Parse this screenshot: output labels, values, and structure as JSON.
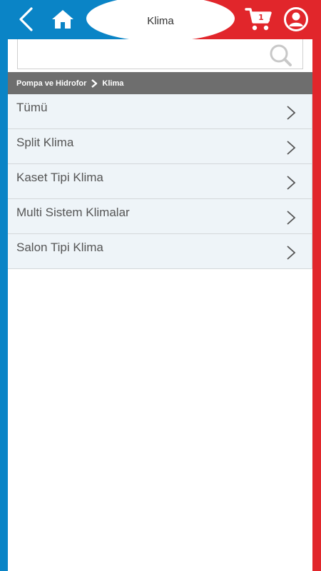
{
  "header": {
    "title": "Klima",
    "icons": {
      "back": "chevron-left-icon",
      "home": "home-icon",
      "cart": "cart-icon",
      "account": "user-icon"
    },
    "cart_count": "1"
  },
  "search": {
    "value": "",
    "placeholder": ""
  },
  "breadcrumb": {
    "items": [
      "Pompa ve Hidrofor",
      "Klima"
    ]
  },
  "categories": {
    "items": [
      {
        "label": "Tümü"
      },
      {
        "label": "Split Klima"
      },
      {
        "label": "Kaset Tipi Klima"
      },
      {
        "label": "Multi Sistem Klimalar"
      },
      {
        "label": "Salon Tipi Klima"
      }
    ]
  },
  "colors": {
    "brand_blue": "#0a84c6",
    "brand_red": "#e1262b",
    "breadcrumb_bg": "#6e6e6e",
    "list_bg": "#eef4f8"
  }
}
